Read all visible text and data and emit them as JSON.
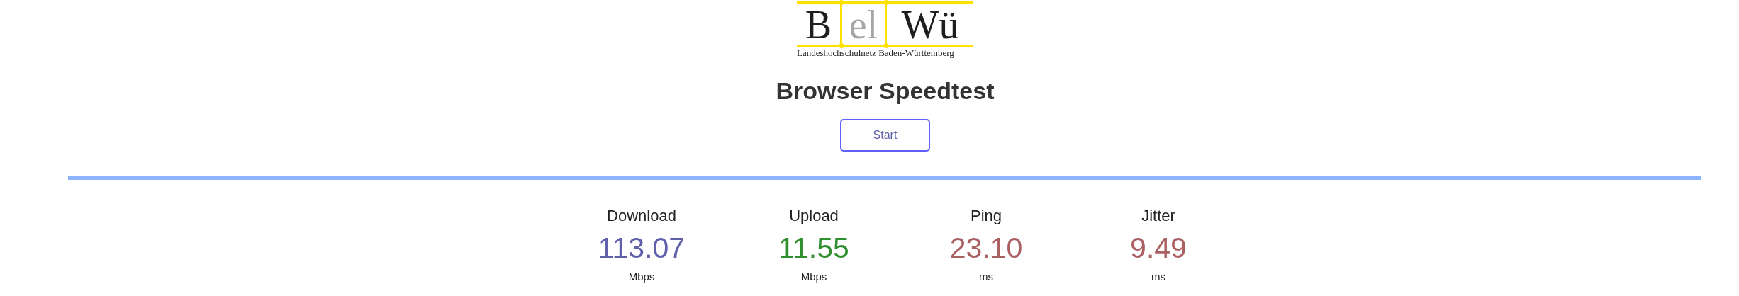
{
  "logo": {
    "letters": [
      {
        "text": "B",
        "kind": "dark"
      },
      {
        "text": "el",
        "kind": "light"
      },
      {
        "text": "Wü",
        "kind": "dark"
      }
    ],
    "subtitle": "Landeshochschulnetz Baden-Württemberg"
  },
  "title": "Browser Speedtest",
  "start_button": "Start",
  "metrics": [
    {
      "label": "Download",
      "value": "113.07",
      "unit": "Mbps",
      "color": "#6060aa"
    },
    {
      "label": "Upload",
      "value": "11.55",
      "unit": "Mbps",
      "color": "#2f8f2f"
    },
    {
      "label": "Ping",
      "value": "23.10",
      "unit": "ms",
      "color": "#aa6060"
    },
    {
      "label": "Jitter",
      "value": "9.49",
      "unit": "ms",
      "color": "#aa6060"
    }
  ]
}
